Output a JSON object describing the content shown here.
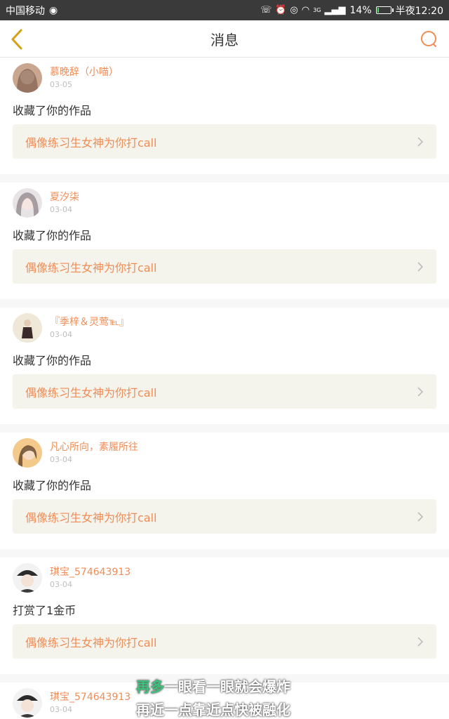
{
  "status_bar": {
    "carrier": "中国移动",
    "network": "3G",
    "battery": "14%",
    "battery_level": 0.14,
    "time": "半夜12:20",
    "colors": {
      "background": "#3a3a3a",
      "battery_fill": "#4cd964"
    }
  },
  "nav": {
    "title": "消息",
    "back_icon": "chevron-left-icon",
    "search_icon": "search-icon",
    "accent": "#f08c55"
  },
  "messages": [
    {
      "user": "慕晚辞（小喵）",
      "date": "03-05",
      "action": "收藏了你的作品",
      "work": "偶像练习生女神为你打call"
    },
    {
      "user": "夏汐柒",
      "date": "03-04",
      "action": "收藏了你的作品",
      "work": "偶像练习生女神为你打call"
    },
    {
      "user": "『季梓＆灵莺℡』",
      "date": "03-04",
      "action": "收藏了你的作品",
      "work": "偶像练习生女神为你打call"
    },
    {
      "user": "凡心所向，素履所往",
      "date": "03-04",
      "action": "收藏了你的作品",
      "work": "偶像练习生女神为你打call"
    },
    {
      "user": "琪宝_574643913",
      "date": "03-04",
      "action": "打赏了1金币",
      "work": "偶像练习生女神为你打call"
    },
    {
      "user": "琪宝_574643913",
      "date": "03-04"
    }
  ],
  "overlay": {
    "line1_highlight": "再多",
    "line1_rest": "一眼看一眼就会爆炸",
    "line2": "再近一点靠近点快被融化"
  }
}
